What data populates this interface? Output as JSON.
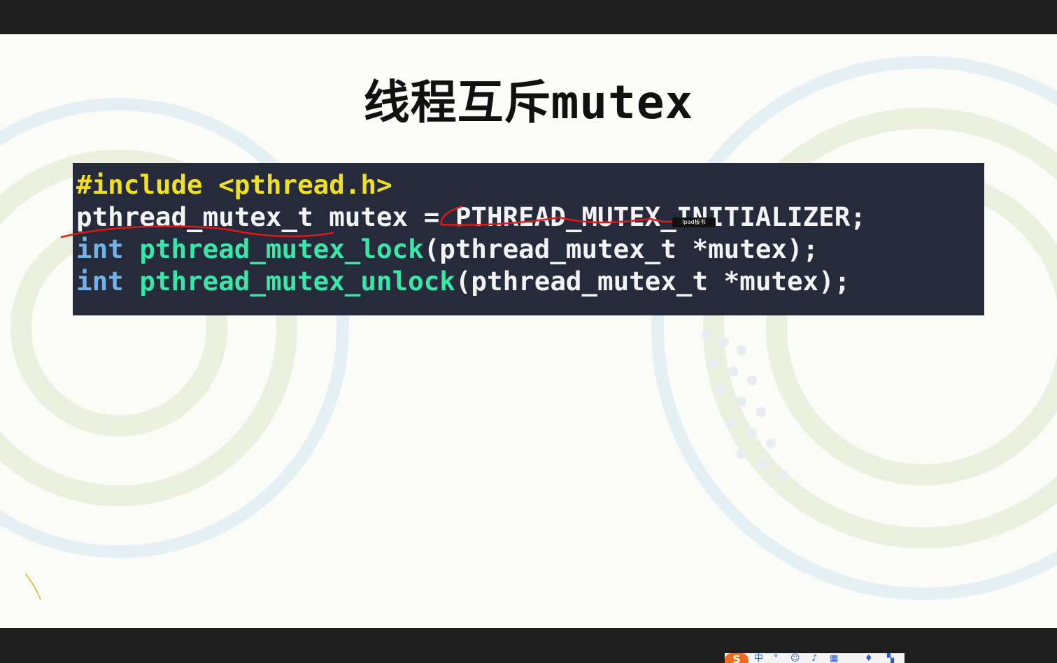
{
  "slide": {
    "title": "线程互斥mutex"
  },
  "code": {
    "line1": "#include <pthread.h>",
    "line2": "pthread_mutex_t mutex = PTHREAD_MUTEX_INITIALIZER;",
    "line3_type": "int",
    "line3_func": "pthread_mutex_lock",
    "line3_args": "(pthread_mutex_t *mutex);",
    "line4_type": "int",
    "line4_func": "pthread_mutex_unlock",
    "line4_args": "(pthread_mutex_t *mutex);"
  },
  "tooltip": {
    "text": "Ipad板书"
  },
  "ime_toolbar": {
    "logo": "S",
    "mode": "中",
    "icons": [
      "punctuation-icon",
      "emoji-icon",
      "microphone-icon",
      "keyboard-icon",
      "skin-icon",
      "apps-icon"
    ]
  },
  "colors": {
    "code_background": "#252b3b",
    "preprocessor": "#f0e020",
    "keyword": "#6fb3e8",
    "function": "#38e8a8",
    "plain": "#f3f3f3",
    "annotation_ink": "#e01818"
  }
}
